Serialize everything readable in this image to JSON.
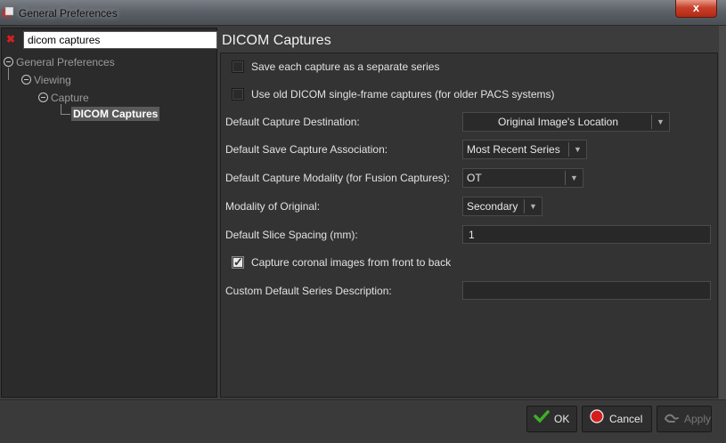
{
  "window": {
    "title": "General Preferences",
    "close_glyph": "x"
  },
  "search": {
    "value": "dicom captures",
    "clear_icon": "red-x-icon"
  },
  "tree": {
    "items": [
      {
        "label": "General Preferences"
      },
      {
        "label": "Viewing"
      },
      {
        "label": "Capture"
      },
      {
        "label": "DICOM Captures",
        "selected": true
      }
    ]
  },
  "panel": {
    "title": "DICOM Captures",
    "separate_series_label": "Save each capture as a separate series",
    "separate_series_checked": false,
    "old_dicom_label": "Use old DICOM single-frame captures (for older PACS systems)",
    "old_dicom_checked": false,
    "destination_label": "Default Capture Destination:",
    "destination_value": "Original Image's Location",
    "association_label": "Default Save Capture Association:",
    "association_value": "Most Recent Series",
    "modality_label": "Default Capture Modality (for Fusion Captures):",
    "modality_value": "OT",
    "original_modality_label": "Modality of Original:",
    "original_modality_value": "Secondary",
    "slice_spacing_label": "Default Slice Spacing (mm):",
    "slice_spacing_value": "1",
    "coronal_label": "Capture coronal images from front to back",
    "coronal_checked": true,
    "series_description_label": "Custom Default Series Description:",
    "series_description_value": ""
  },
  "footer": {
    "ok_label": "OK",
    "cancel_label": "Cancel",
    "apply_label": "Apply"
  },
  "colors": {
    "ok_icon": "#3fae2a",
    "cancel_icon": "#d41e1e",
    "close_button": "#c8402a"
  }
}
